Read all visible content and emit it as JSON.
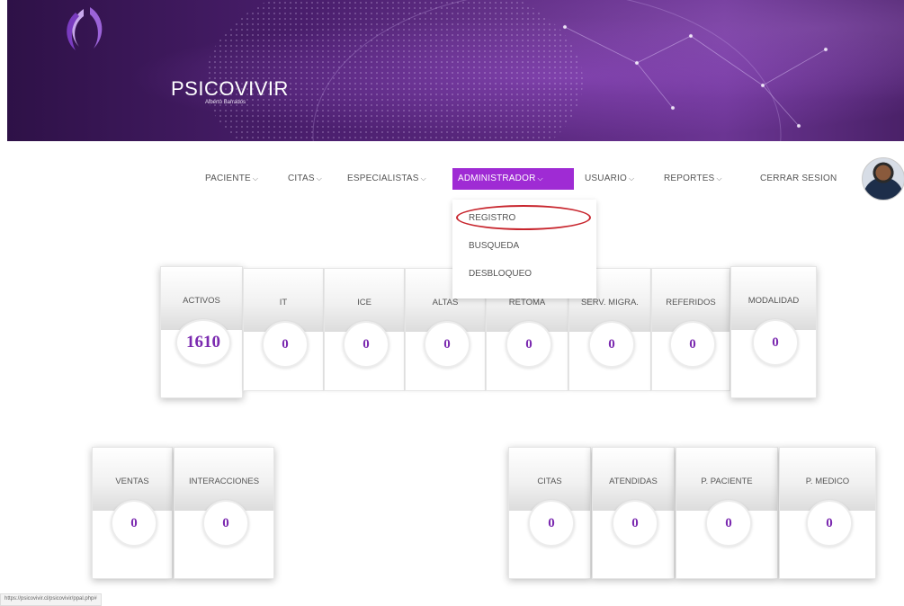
{
  "brand": {
    "name": "PSICOVIVIR",
    "subtitle": "Alberto Barrados"
  },
  "nav": {
    "items": [
      {
        "label": "PACIENTE"
      },
      {
        "label": "CITAS"
      },
      {
        "label": "ESPECIALISTAS"
      },
      {
        "label": "ADMINISTRADOR"
      },
      {
        "label": "USUARIO"
      },
      {
        "label": "REPORTES"
      },
      {
        "label": "CERRAR SESION"
      }
    ],
    "chevron": "⌵",
    "active_color": "#9f2bd4"
  },
  "dropdown": {
    "items": [
      {
        "label": "REGISTRO"
      },
      {
        "label": "BUSQUEDA"
      },
      {
        "label": "DESBLOQUEO"
      }
    ],
    "highlight_color": "#c8262e"
  },
  "stats_top": [
    {
      "label": "ACTIVOS",
      "value": "1610"
    },
    {
      "label": "IT",
      "value": "0"
    },
    {
      "label": "ICE",
      "value": "0"
    },
    {
      "label": "ALTAS",
      "value": "0"
    },
    {
      "label": "RETOMA",
      "value": "0"
    },
    {
      "label": "SERV. MIGRA.",
      "value": "0"
    },
    {
      "label": "REFERIDOS",
      "value": "0"
    },
    {
      "label": "MODALIDAD",
      "value": "0"
    }
  ],
  "stats_left": [
    {
      "label": "VENTAS",
      "value": "0"
    },
    {
      "label": "INTERACCIONES",
      "value": "0"
    }
  ],
  "stats_right": [
    {
      "label": "CITAS",
      "value": "0"
    },
    {
      "label": "ATENDIDAS",
      "value": "0"
    },
    {
      "label": "P. PACIENTE",
      "value": "0"
    },
    {
      "label": "P. MEDICO",
      "value": "0"
    }
  ],
  "status_url": "https://psicovivir.cl/psicovivir/ppal.php#",
  "colors": {
    "accent": "#7b2ab0",
    "banner": "#4b1f6e"
  }
}
